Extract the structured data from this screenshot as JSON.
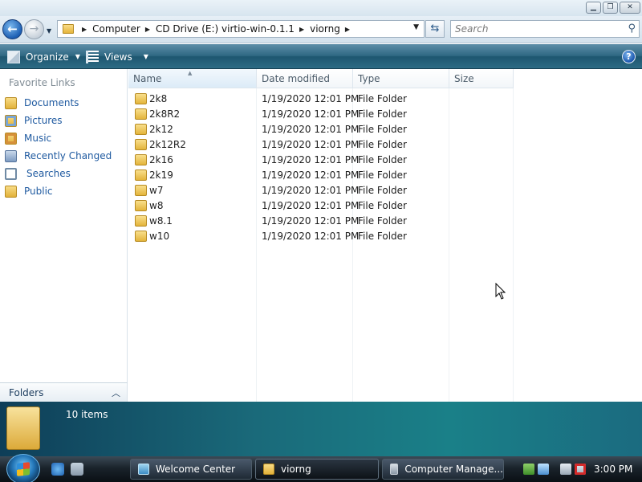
{
  "window": {
    "controls": {
      "minimize": "▁",
      "maximize": "❐",
      "close": "✕"
    }
  },
  "address": {
    "back_glyph": "←",
    "forward_glyph": "→",
    "breadcrumbs": [
      "Computer",
      "CD Drive (E:) virtio-win-0.1.1",
      "viorng"
    ],
    "refresh_glyph": "⇆",
    "search_placeholder": "Search"
  },
  "commandbar": {
    "organize_label": "Organize",
    "views_label": "Views",
    "help_glyph": "?"
  },
  "navpane": {
    "heading": "Favorite Links",
    "links": [
      {
        "label": "Documents",
        "icon": "documents-folder-icon"
      },
      {
        "label": "Pictures",
        "icon": "pictures-folder-icon"
      },
      {
        "label": "Music",
        "icon": "music-folder-icon"
      },
      {
        "label": "Recently Changed",
        "icon": "recently-changed-icon"
      },
      {
        "label": "Searches",
        "icon": "searches-icon"
      },
      {
        "label": "Public",
        "icon": "public-folder-icon"
      }
    ],
    "folders_label": "Folders"
  },
  "filelist": {
    "columns": [
      "Name",
      "Date modified",
      "Type",
      "Size"
    ],
    "rows": [
      {
        "name": "2k8",
        "date": "1/19/2020 12:01 PM",
        "type": "File Folder",
        "size": ""
      },
      {
        "name": "2k8R2",
        "date": "1/19/2020 12:01 PM",
        "type": "File Folder",
        "size": ""
      },
      {
        "name": "2k12",
        "date": "1/19/2020 12:01 PM",
        "type": "File Folder",
        "size": ""
      },
      {
        "name": "2k12R2",
        "date": "1/19/2020 12:01 PM",
        "type": "File Folder",
        "size": ""
      },
      {
        "name": "2k16",
        "date": "1/19/2020 12:01 PM",
        "type": "File Folder",
        "size": ""
      },
      {
        "name": "2k19",
        "date": "1/19/2020 12:01 PM",
        "type": "File Folder",
        "size": ""
      },
      {
        "name": "w7",
        "date": "1/19/2020 12:01 PM",
        "type": "File Folder",
        "size": ""
      },
      {
        "name": "w8",
        "date": "1/19/2020 12:01 PM",
        "type": "File Folder",
        "size": ""
      },
      {
        "name": "w8.1",
        "date": "1/19/2020 12:01 PM",
        "type": "File Folder",
        "size": ""
      },
      {
        "name": "w10",
        "date": "1/19/2020 12:01 PM",
        "type": "File Folder",
        "size": ""
      }
    ]
  },
  "details": {
    "item_count": "10 items"
  },
  "taskbar": {
    "tasks": [
      {
        "label": "Welcome Center",
        "icon": "welcome-center-icon"
      },
      {
        "label": "viorng",
        "icon": "folder-icon"
      },
      {
        "label": "Computer Manage...",
        "icon": "computer-management-icon"
      }
    ],
    "clock": "3:00 PM"
  },
  "colors": {
    "link_blue": "#1f5aa0",
    "commandbar": "#2f6883",
    "details_teal": "#1a8088"
  }
}
